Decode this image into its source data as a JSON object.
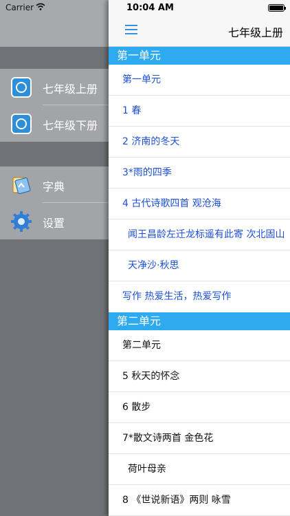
{
  "status_bar": {
    "carrier": "Carrier",
    "time": "10:04 AM"
  },
  "navbar": {
    "title": "七年级上册"
  },
  "left_menu": {
    "books": [
      {
        "label": "七年级上册"
      },
      {
        "label": "七年级下册"
      }
    ],
    "tools": [
      {
        "label": "字典"
      },
      {
        "label": "设置"
      }
    ]
  },
  "sections": [
    {
      "header": "第一单元",
      "items": [
        {
          "label": "第一单元"
        },
        {
          "label": "1 春"
        },
        {
          "label": "2 济南的冬天"
        },
        {
          "label": "3*雨的四季"
        },
        {
          "label": "4 古代诗歌四首  观沧海"
        },
        {
          "label": "闻王昌龄左迁龙标遥有此寄  次北固山"
        },
        {
          "label": "天净沙·秋思"
        },
        {
          "label": "写作 热爱生活，热爱写作"
        }
      ]
    },
    {
      "header": "第二单元",
      "items": [
        {
          "label": "第二单元"
        },
        {
          "label": "5 秋天的怀念"
        },
        {
          "label": "6 散步"
        },
        {
          "label": "7*散文诗两首  金色花"
        },
        {
          "label": "荷叶母亲"
        },
        {
          "label": "8 《世说新语》两则  咏雪"
        }
      ]
    }
  ],
  "colors": {
    "section_header": "#2eaaf0",
    "link_text": "#1d4fd8",
    "menu_icon": "#3a8fe0"
  }
}
